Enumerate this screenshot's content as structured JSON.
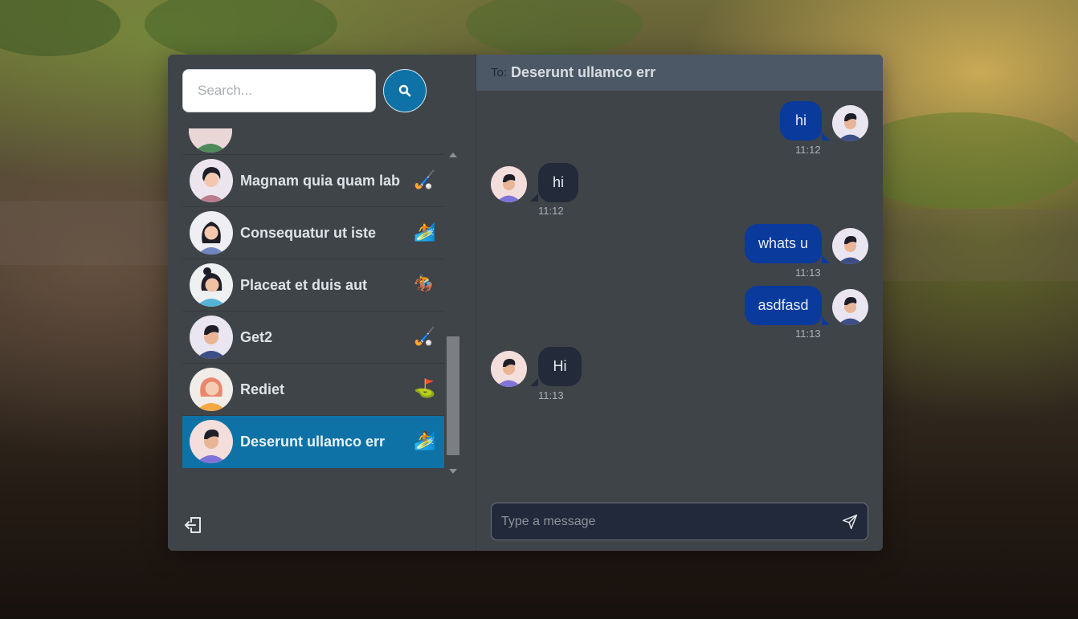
{
  "search": {
    "placeholder": "Search..."
  },
  "contacts": [
    {
      "name": "Magnam quia quam lab",
      "emoji": "🏑",
      "active": false
    },
    {
      "name": "Consequatur ut iste",
      "emoji": "🏄",
      "active": false
    },
    {
      "name": "Placeat et duis aut",
      "emoji": "🏇",
      "active": false
    },
    {
      "name": "Get2",
      "emoji": "🏑",
      "active": false
    },
    {
      "name": "Rediet",
      "emoji": "⛳",
      "active": false
    },
    {
      "name": "Deserunt ullamco err",
      "emoji": "🏄",
      "active": true
    }
  ],
  "conversation": {
    "to_label": "To:",
    "to_name": "Deserunt ullamco err",
    "messages": [
      {
        "direction": "out",
        "text": "hi",
        "time": "11:12"
      },
      {
        "direction": "in",
        "text": "hi",
        "time": "11:12"
      },
      {
        "direction": "out",
        "text": "whats u",
        "time": "11:13"
      },
      {
        "direction": "out",
        "text": "asdfasd",
        "time": "11:13"
      },
      {
        "direction": "in",
        "text": "Hi",
        "time": "11:13"
      }
    ],
    "composer_placeholder": "Type a message"
  },
  "colors": {
    "accent": "#0f72a6",
    "outgoing_bubble": "#0a3a9c",
    "incoming_bubble": "#232a3a",
    "panel": "#3f4449",
    "header": "#4d5866"
  },
  "icons": {
    "search": "search-icon",
    "logout": "logout-icon",
    "send": "send-icon"
  }
}
